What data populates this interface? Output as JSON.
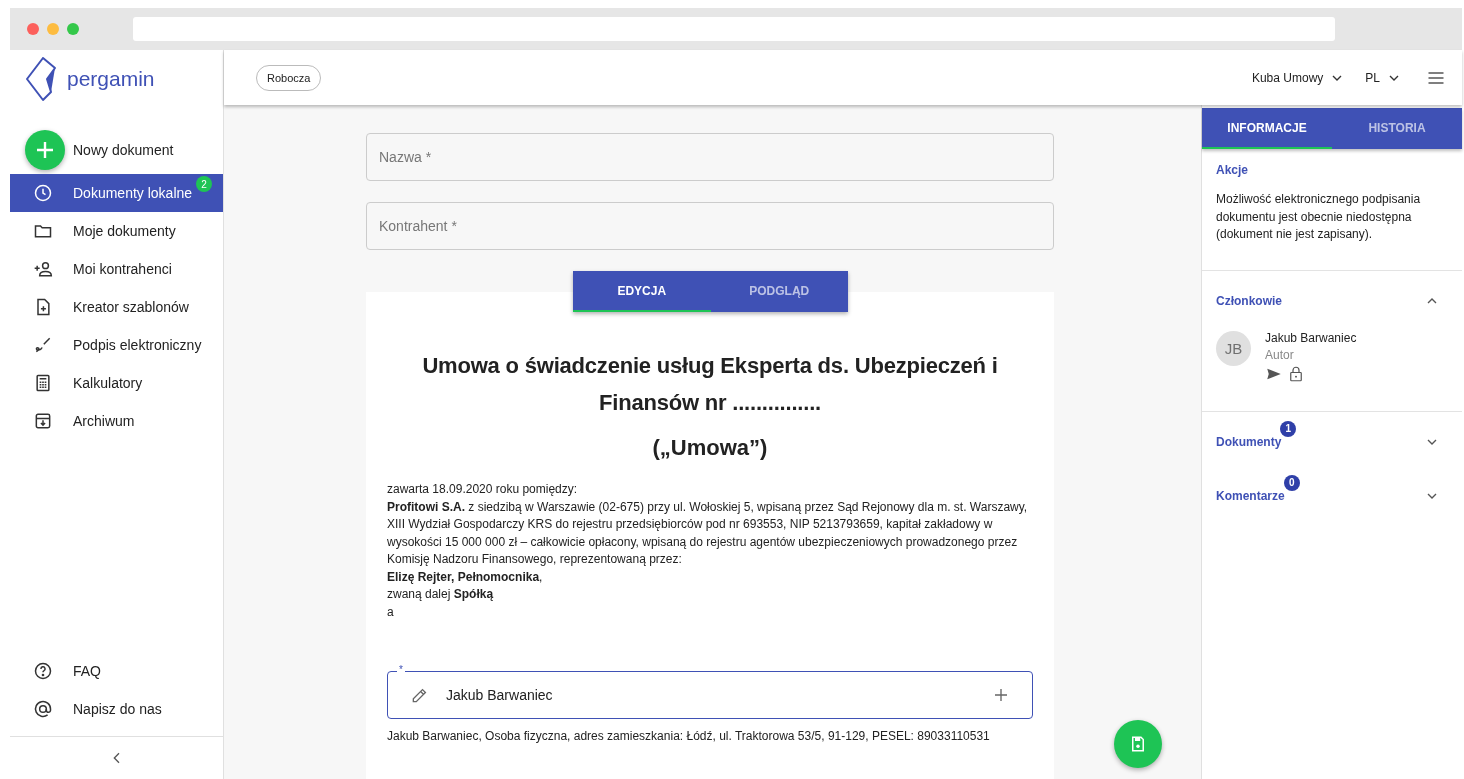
{
  "sidebar": {
    "logo": "pergamin",
    "new_document": "Nowy dokument",
    "items": [
      {
        "label": "Dokumenty lokalne",
        "selected": true,
        "badge": "2"
      },
      {
        "label": "Moje dokumenty",
        "selected": false
      },
      {
        "label": "Moi kontrahenci",
        "selected": false
      },
      {
        "label": "Kreator szablonów",
        "selected": false
      },
      {
        "label": "Podpis elektroniczny",
        "selected": false
      },
      {
        "label": "Kalkulatory",
        "selected": false
      },
      {
        "label": "Archiwum",
        "selected": false
      }
    ],
    "footer_items": [
      {
        "label": "FAQ"
      },
      {
        "label": "Napisz do nas"
      }
    ]
  },
  "topbar": {
    "status": "Robocza",
    "user": "Kuba Umowy",
    "language": "PL"
  },
  "fields": [
    {
      "placeholder": "Nazwa *"
    },
    {
      "placeholder": "Kontrahent *"
    }
  ],
  "editor_tabs": [
    {
      "label": "EDYCJA",
      "selected": true
    },
    {
      "label": "PODGLĄD",
      "selected": false
    }
  ],
  "document": {
    "title": "Umowa o świadczenie usług Eksperta ds. Ubezpieczeń i Finansów nr  ...............",
    "subtitle": "(„Umowa”)",
    "paragraphs": [
      "zawarta 18.09.2020 roku pomiędzy:",
      "**Profitowi S.A.** z siedzibą w Warszawie (02-675) przy ul. Wołoskiej 5, wpisaną przez Sąd Rejonowy dla m. st. Warszawy, XIII Wydział Gospodarczy KRS do rejestru przedsiębiorców pod nr 693553, NIP 5213793659, kapitał zakładowy w wysokości 15 000 000 zł – całkowicie opłacony, wpisaną do rejestru agentów ubezpieczeniowych prowadzonego przez Komisję Nadzoru Finansowego, reprezentowaną przez:",
      "**Elizę Rejter, Pełnomocnika**,",
      "zwaną dalej **Spółką**",
      "a"
    ],
    "party_field": {
      "label": "*",
      "value": "Jakub Barwaniec"
    },
    "party_details": "Jakub Barwaniec, Osoba fizyczna, adres zamieszkania: Łódź, ul. Traktorowa 53/5, 91-129, PESEL: 89033110531"
  },
  "info_panel": {
    "tabs": [
      {
        "label": "INFORMACJE",
        "selected": true
      },
      {
        "label": "HISTORIA",
        "selected": false
      }
    ],
    "actions": {
      "title": "Akcje",
      "text": "Możliwość elektronicznego podpisania dokumentu jest obecnie niedostępna (dokument nie jest zapisany)."
    },
    "sections": [
      {
        "title": "Członkowie",
        "expanded": true,
        "members": [
          {
            "initials": "JB",
            "name": "Jakub Barwaniec",
            "role": "Autor"
          }
        ]
      },
      {
        "title": "Dokumenty",
        "expanded": false,
        "badge": "1"
      },
      {
        "title": "Komentarze",
        "expanded": false,
        "badge": "0"
      }
    ]
  }
}
